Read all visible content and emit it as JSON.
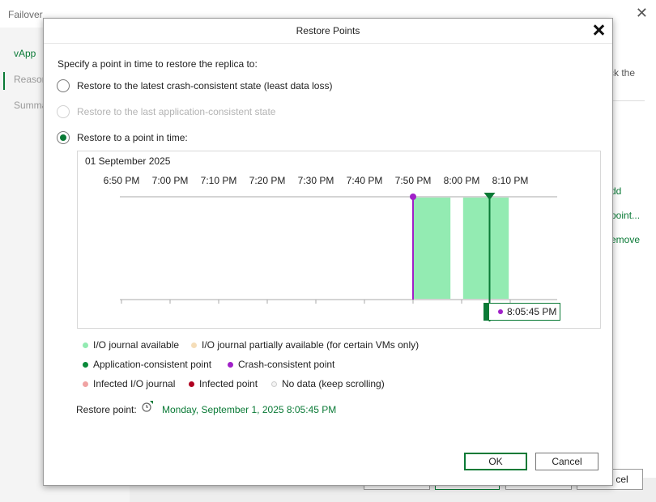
{
  "background": {
    "window_title": "Failover",
    "sidebar": [
      "vApp",
      "Reason",
      "Summary"
    ],
    "main_text_fragment": "ck the",
    "links": [
      "dd",
      "point...",
      "emove"
    ],
    "cancel_fragment": "cel"
  },
  "dialog": {
    "title": "Restore Points",
    "prompt": "Specify a point in time to restore the replica to:",
    "options": [
      {
        "label": "Restore to the latest crash-consistent state (least data loss)",
        "checked": false,
        "disabled": false
      },
      {
        "label": "Restore to the last application-consistent state",
        "checked": false,
        "disabled": true
      },
      {
        "label": "Restore to a point in time:",
        "checked": true,
        "disabled": false
      }
    ],
    "timeline": {
      "date": "01 September 2025",
      "ticks": [
        "6:50 PM",
        "7:00 PM",
        "7:10 PM",
        "7:20 PM",
        "7:30 PM",
        "7:40 PM",
        "7:50 PM",
        "8:00 PM",
        "8:10 PM"
      ],
      "journal_segments": [
        {
          "start_min": 60,
          "end_min": 67.7
        },
        {
          "start_min": 70.3,
          "end_min": 79.7
        }
      ],
      "crash_point_min": 60,
      "selected_min": 75.75,
      "selected_label": "8:05:45 PM",
      "colors": {
        "journal": "#93ebb2",
        "selected": "#0a7a36",
        "crash": "#a020c8",
        "axis": "#aaaaaa"
      }
    },
    "legend": [
      {
        "label": "I/O journal available",
        "color": "#93ebb2"
      },
      {
        "label": "I/O journal partially available (for certain VMs only)",
        "color": "#f5ddb8"
      },
      {
        "label": "Application-consistent point",
        "color": "#0a8a3a"
      },
      {
        "label": "Crash-consistent point",
        "color": "#a020c8"
      },
      {
        "label": "Infected I/O journal",
        "color": "#f0a3a3"
      },
      {
        "label": "Infected point",
        "color": "#b00020"
      },
      {
        "label": "No data (keep scrolling)",
        "color": "#f4f4f4"
      }
    ],
    "restore_point_label": "Restore point:",
    "restore_point_value": "Monday, September 1, 2025 8:05:45 PM",
    "ok_label": "OK",
    "cancel_label": "Cancel"
  }
}
